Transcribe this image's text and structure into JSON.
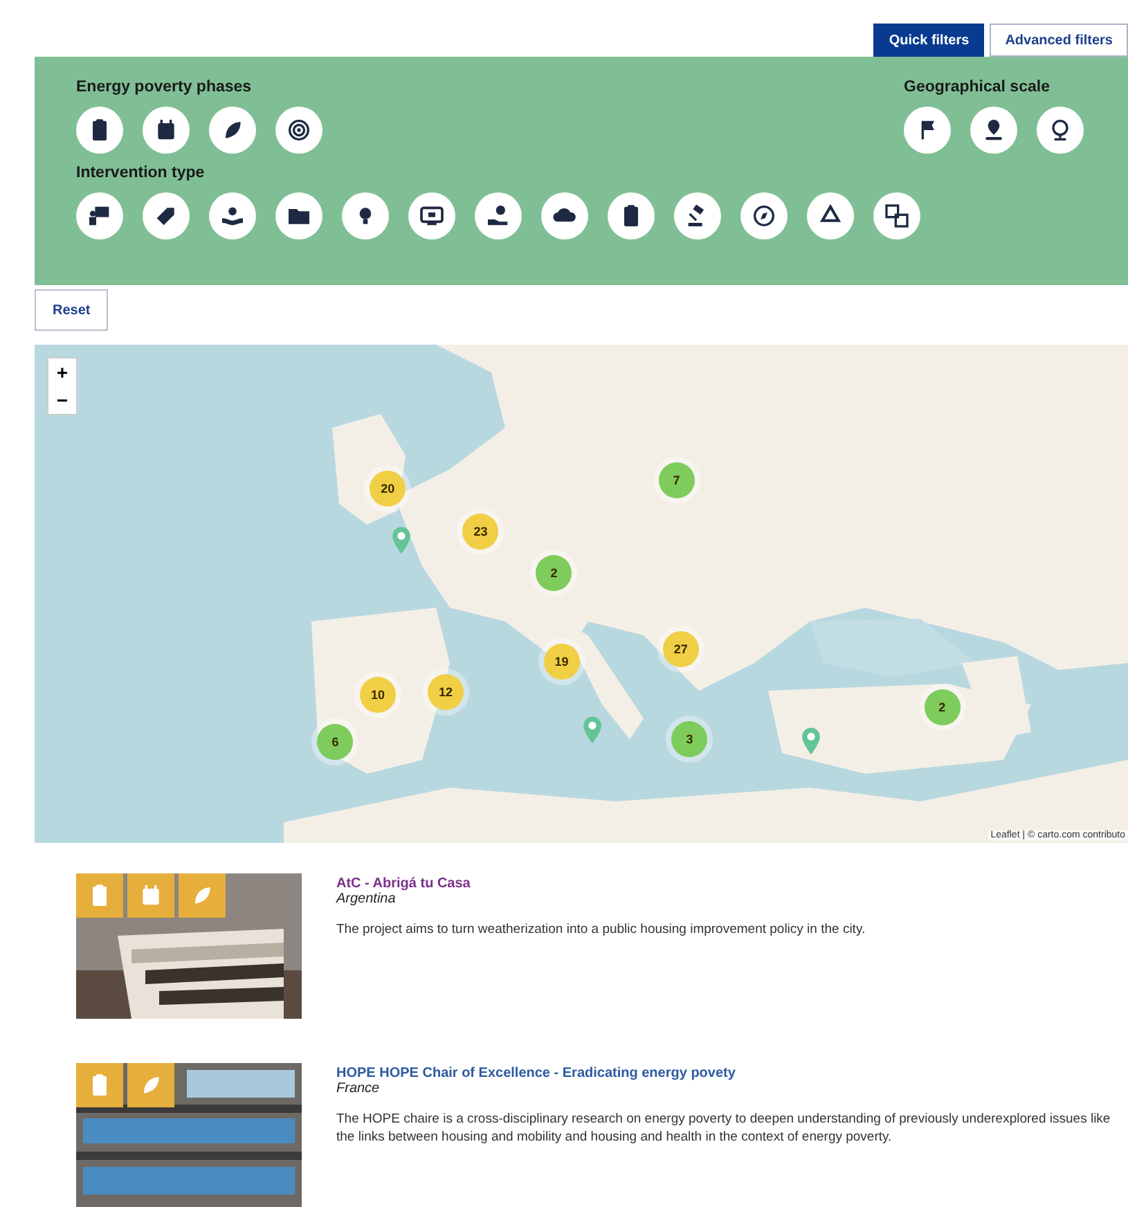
{
  "filter_tabs": [
    {
      "label": "Quick filters",
      "selected": true
    },
    {
      "label": "Advanced filters",
      "selected": false
    }
  ],
  "filters": {
    "phases": {
      "title": "Energy poverty phases",
      "icons": [
        {
          "kind": "clipboard"
        },
        {
          "kind": "calendar"
        },
        {
          "kind": "leaf"
        },
        {
          "kind": "target"
        }
      ]
    },
    "scale": {
      "title": "Geographical scale",
      "icons": [
        {
          "kind": "flag"
        },
        {
          "kind": "pin"
        },
        {
          "kind": "globe"
        }
      ]
    },
    "intervention": {
      "title": "Intervention type",
      "icons": [
        {
          "kind": "board"
        },
        {
          "kind": "tag"
        },
        {
          "kind": "hands"
        },
        {
          "kind": "folder"
        },
        {
          "kind": "bulb"
        },
        {
          "kind": "monitor"
        },
        {
          "kind": "coin"
        },
        {
          "kind": "cloud"
        },
        {
          "kind": "clipboard"
        },
        {
          "kind": "gavel"
        },
        {
          "kind": "compass"
        },
        {
          "kind": "recycle"
        },
        {
          "kind": "translate"
        }
      ]
    }
  },
  "reset_button": "Reset",
  "map": {
    "zoom_in": "+",
    "zoom_out": "−",
    "attribution": "Leaflet | © carto.com contributo",
    "markers": [
      {
        "kind": "cluster",
        "count": "20",
        "color": "#f0cf45"
      },
      {
        "kind": "cluster",
        "count": "23",
        "color": "#f0cf45"
      },
      {
        "kind": "cluster",
        "count": "7",
        "color": "#7dcc5c"
      },
      {
        "kind": "cluster",
        "count": "2",
        "color": "#7dcc5c"
      },
      {
        "kind": "cluster",
        "count": "19",
        "color": "#f0cf45"
      },
      {
        "kind": "cluster",
        "count": "27",
        "color": "#f0cf45"
      },
      {
        "kind": "cluster",
        "count": "10",
        "color": "#f0cf45"
      },
      {
        "kind": "cluster",
        "count": "12",
        "color": "#f0cf45"
      },
      {
        "kind": "cluster",
        "count": "6",
        "color": "#7dcc5c"
      },
      {
        "kind": "cluster",
        "count": "3",
        "color": "#7dcc5c"
      },
      {
        "kind": "cluster",
        "count": "2",
        "color": "#7dcc5c"
      },
      {
        "kind": "pin"
      },
      {
        "kind": "pin"
      },
      {
        "kind": "pin"
      }
    ]
  },
  "results": [
    {
      "title": "AtC - Abrigá tu Casa",
      "visited": true,
      "country": "Argentina",
      "description": "The project aims to turn weatherization into a public housing improvement policy in the city.",
      "phase_icons": [
        {
          "kind": "clipboard"
        },
        {
          "kind": "calendar"
        },
        {
          "kind": "leaf"
        }
      ]
    },
    {
      "title": "HOPE HOPE Chair of Excellence - Eradicating energy povety",
      "visited": false,
      "country": "France",
      "description": "The HOPE chaire is a cross-disciplinary research on energy poverty to deepen understanding of previously underexplored issues like the links between housing and mobility and housing and health in the context of energy poverty.",
      "phase_icons": [
        {
          "kind": "clipboard"
        },
        {
          "kind": "leaf"
        }
      ]
    }
  ]
}
